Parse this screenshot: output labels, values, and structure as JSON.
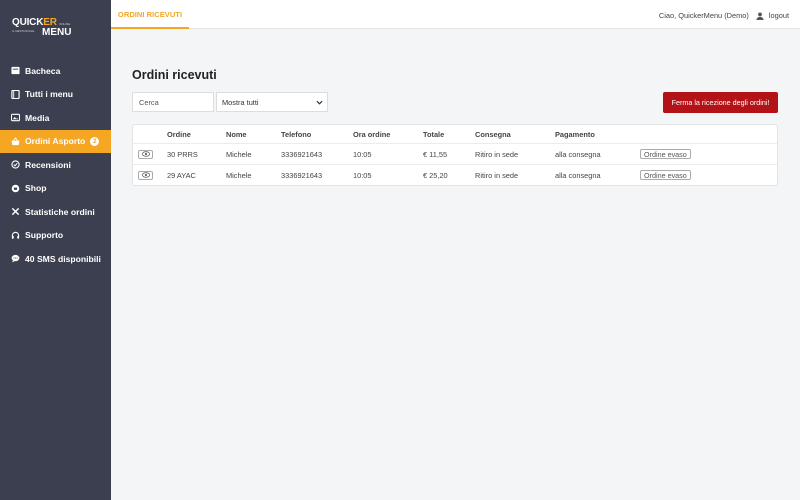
{
  "brand": {
    "logo_top_a": "QUICK",
    "logo_top_b": "ER",
    "logo_bottom": "MENU",
    "tagline_online": "ONLINE",
    "tagline_sub": "IL GESTIONALE",
    "accent_color": "#f5a623",
    "sidebar_color": "#3c3f4f",
    "danger_color": "#b31217"
  },
  "sidebar": {
    "items": [
      {
        "label": "Bacheca",
        "icon": "dashboard-icon"
      },
      {
        "label": "Tutti i menu",
        "icon": "book-icon"
      },
      {
        "label": "Media",
        "icon": "image-icon"
      },
      {
        "label": "Ordini Asporto",
        "icon": "basket-icon",
        "badge": "2",
        "active": true
      },
      {
        "label": "Recensioni",
        "icon": "check-circle-icon"
      },
      {
        "label": "Shop",
        "icon": "shop-icon"
      },
      {
        "label": "Statistiche ordini",
        "icon": "tools-icon"
      },
      {
        "label": "Supporto",
        "icon": "support-icon"
      },
      {
        "label": "40 SMS disponibili",
        "icon": "chat-icon"
      }
    ]
  },
  "topbar": {
    "tab_label": "ORDINI RICEVUTI",
    "greeting": "Ciao, QuickerMenu (Demo)",
    "logout_label": "logout"
  },
  "main": {
    "title": "Ordini ricevuti",
    "search_placeholder": "Cerca",
    "filter_value": "Mostra tutti",
    "stop_button_label": "Ferma la ricezione degli ordini!"
  },
  "table": {
    "columns": [
      "Ordine",
      "Nome",
      "Telefono",
      "Ora ordine",
      "Totale",
      "Consegna",
      "Pagamento"
    ],
    "rows": [
      {
        "ordine": "30 PRRS",
        "nome": "Michele",
        "telefono": "3336921643",
        "ora": "10:05",
        "totale": "€ 11,55",
        "consegna": "Ritiro in sede",
        "pagamento": "alla consegna",
        "stato": "Ordine evaso"
      },
      {
        "ordine": "29 AYAC",
        "nome": "Michele",
        "telefono": "3336921643",
        "ora": "10:05",
        "totale": "€ 25,20",
        "consegna": "Ritiro in sede",
        "pagamento": "alla consegna",
        "stato": "Ordine evaso"
      }
    ]
  }
}
